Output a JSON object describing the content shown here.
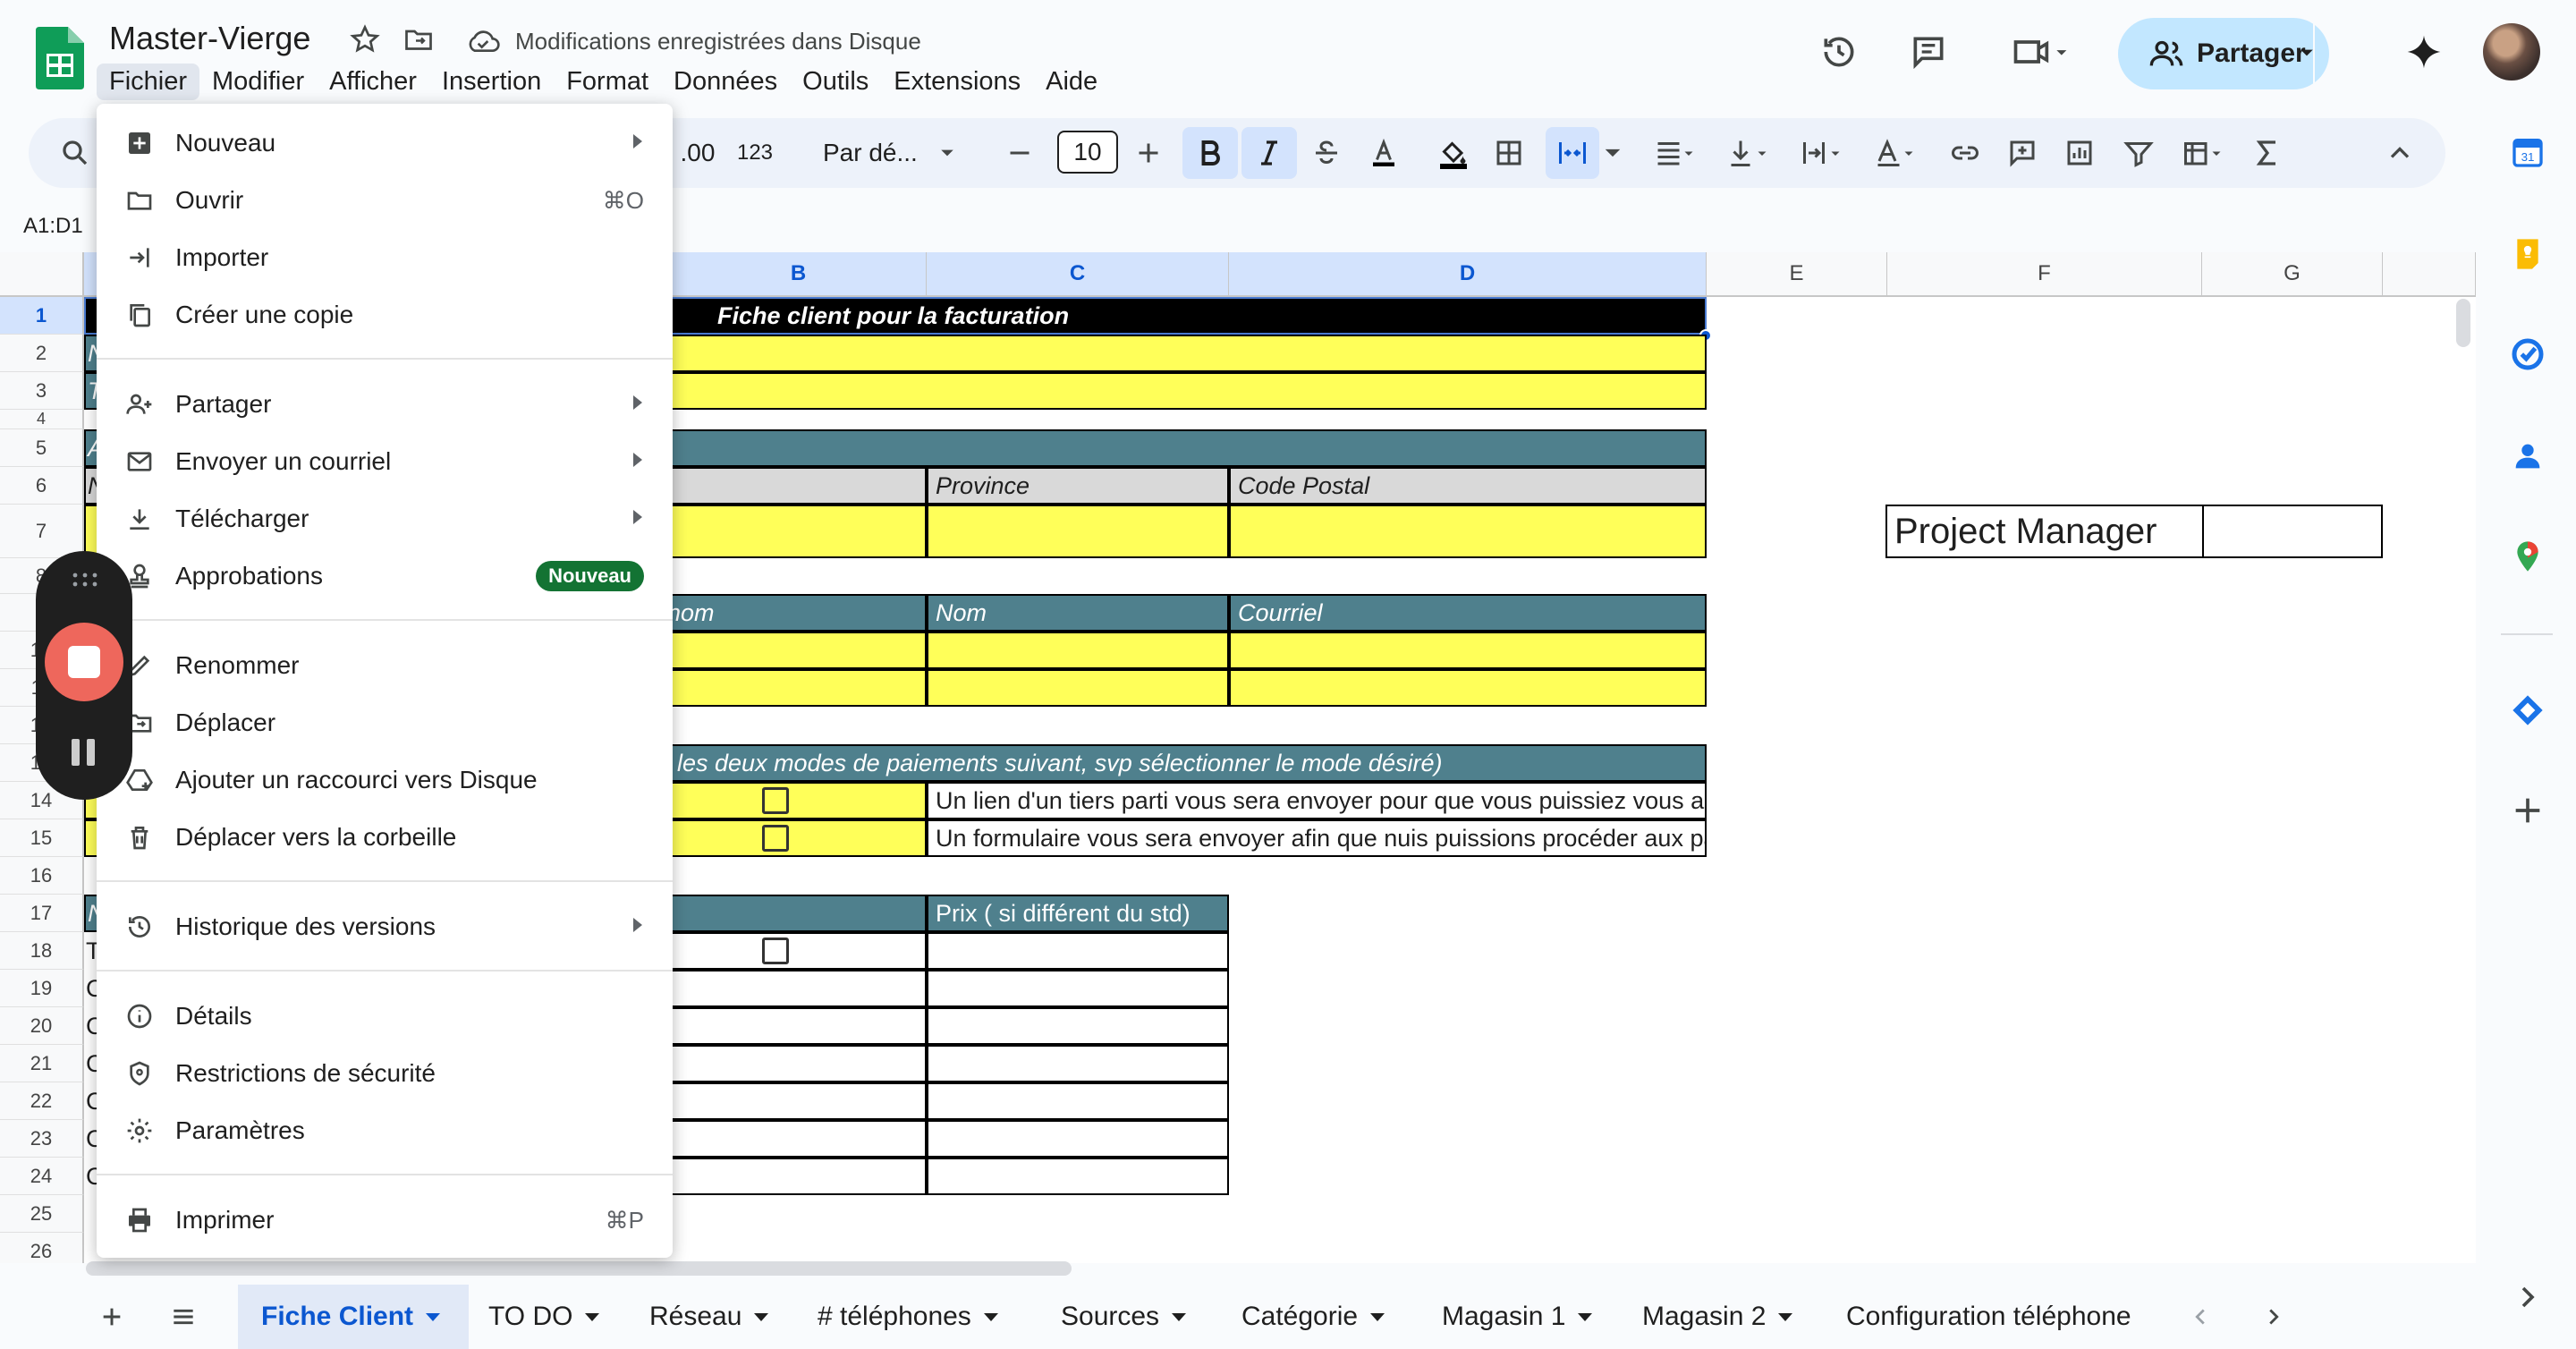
{
  "header": {
    "doc_title": "Master-Vierge",
    "save_status": "Modifications enregistrées dans Disque",
    "share_label": "Partager"
  },
  "menubar": [
    "Fichier",
    "Modifier",
    "Afficher",
    "Insertion",
    "Format",
    "Données",
    "Outils",
    "Extensions",
    "Aide"
  ],
  "toolbar": {
    "decimal_label": ".00",
    "format_123": "123",
    "font_name": "Par dé...",
    "font_size": "10"
  },
  "namebox": "A1:D1",
  "columns": [
    "B",
    "C",
    "D",
    "E",
    "F",
    "G"
  ],
  "rows": [
    "1",
    "2",
    "3",
    "4",
    "5",
    "6",
    "7",
    "8",
    "9",
    "10",
    "11",
    "12",
    "13",
    "14",
    "15",
    "16",
    "17",
    "18",
    "19",
    "20",
    "21",
    "22",
    "23",
    "24",
    "25",
    "26"
  ],
  "cells": {
    "title_banner": "Fiche client pour la facturation",
    "province": "Province",
    "code_postal": "Code Postal",
    "prenom_partial": "e",
    "prenom2_partial": "nom",
    "nom": "Nom",
    "courriel": "Courriel",
    "payment_header": "c les deux modes de paiements suivant, svp sélectionner le mode désiré)",
    "payment_opt1": "Un lien d'un tiers parti vous sera envoyer pour que vous puissiez vous ab",
    "payment_opt2": "Un formulaire vous sera envoyer afin que nuis puissions procéder aux pa",
    "prix_header": "Prix ( si différent du std)",
    "project_manager": "Project Manager",
    "left_letters": [
      "N",
      "T",
      "A",
      "N",
      "N",
      "T",
      "C",
      "C",
      "C",
      "C",
      "C",
      "C"
    ]
  },
  "file_menu": [
    {
      "label": "Nouveau",
      "icon": "new-sheet-icon",
      "submenu": true
    },
    {
      "label": "Ouvrir",
      "icon": "folder-icon",
      "shortcut": "⌘O"
    },
    {
      "label": "Importer",
      "icon": "import-icon"
    },
    {
      "label": "Créer une copie",
      "icon": "copy-icon"
    },
    {
      "label": "Partager",
      "icon": "share-person-icon",
      "submenu": true
    },
    {
      "label": "Envoyer un courriel",
      "icon": "mail-icon",
      "submenu": true
    },
    {
      "label": "Télécharger",
      "icon": "download-icon",
      "submenu": true
    },
    {
      "label": "Approbations",
      "icon": "approval-icon",
      "badge": "Nouveau"
    },
    {
      "label": "Renommer",
      "icon": "rename-icon"
    },
    {
      "label": "Déplacer",
      "icon": "move-icon"
    },
    {
      "label": "Ajouter un raccourci vers Disque",
      "icon": "drive-shortcut-icon"
    },
    {
      "label": "Déplacer vers la corbeille",
      "icon": "trash-icon"
    },
    {
      "label": "Historique des versions",
      "icon": "history-icon",
      "submenu": true
    },
    {
      "label": "Détails",
      "icon": "info-icon"
    },
    {
      "label": "Restrictions de sécurité",
      "icon": "security-icon"
    },
    {
      "label": "Paramètres",
      "icon": "gear-icon"
    },
    {
      "label": "Imprimer",
      "icon": "print-icon",
      "shortcut": "⌘P"
    }
  ],
  "tabs": [
    "Fiche Client",
    "TO DO",
    "Réseau",
    "# téléphones",
    "Sources",
    "Catégorie",
    "Magasin 1",
    "Magasin 2",
    "Configuration téléphone"
  ],
  "colors": {
    "yellow": "#ffff59",
    "teal": "#4f808d",
    "accent_blue": "#0b57d0",
    "share_bg": "#c2e7ff",
    "badge_green": "#137333",
    "recorder_red": "#ee675c"
  }
}
